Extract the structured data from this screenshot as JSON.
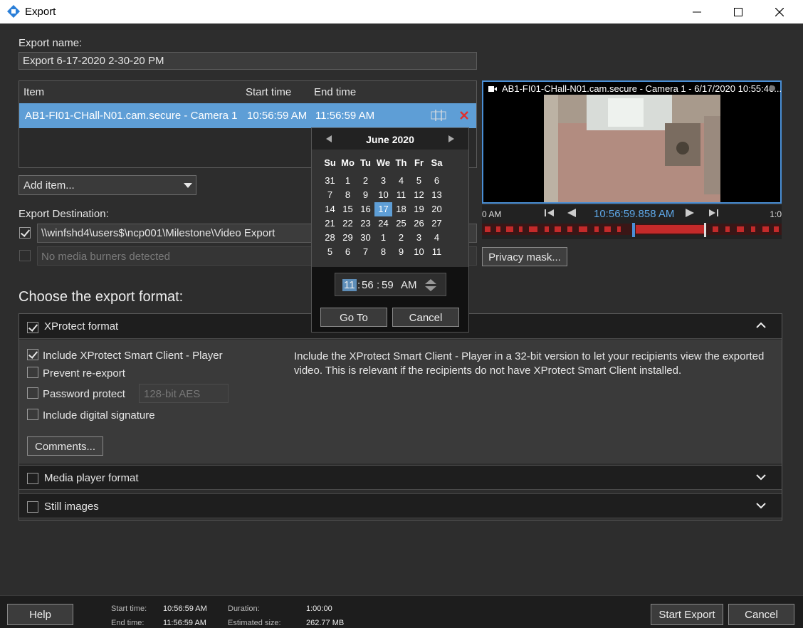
{
  "window": {
    "title": "Export",
    "minimize_icon": "minimize-icon",
    "maximize_icon": "maximize-icon",
    "close_icon": "close-icon"
  },
  "export_name": {
    "label": "Export name:",
    "value": "Export 6-17-2020 2-30-20 PM"
  },
  "items_table": {
    "columns": [
      "Item",
      "Start time",
      "End time"
    ],
    "rows": [
      {
        "item": "AB1-FI01-CHall-N01.cam.secure - Camera 1",
        "start": "10:56:59 AM",
        "end": "11:56:59 AM"
      }
    ],
    "add_item_label": "Add item..."
  },
  "destination": {
    "label": "Export Destination:",
    "path": "\\\\winfshd4\\users$\\ncp001\\Milestone\\Video Export",
    "path_checked": true,
    "burner_text": "No media burners detected",
    "burner_checked": false
  },
  "format_section": {
    "title": "Choose the export format:",
    "xprotect": {
      "label": "XProtect format",
      "checked": true,
      "options": {
        "include_player": "Include XProtect Smart Client - Player",
        "prevent_reexport": "Prevent re-export",
        "password_protect": "Password protect",
        "encryption": "128-bit AES",
        "digital_signature": "Include digital signature"
      },
      "description": "Include the XProtect Smart Client - Player in a 32-bit version to let your recipients view the exported video. This is relevant if the recipients do not have XProtect Smart Client installed.",
      "comments_label": "Comments..."
    },
    "media_player": {
      "label": "Media player format",
      "checked": false
    },
    "still_images": {
      "label": "Still images",
      "checked": false
    }
  },
  "preview": {
    "camera_title": "AB1-FI01-CHall-N01.cam.secure - Camera 1 - 6/17/2020 10:55:46...",
    "current_time": "10:56:59.858 AM",
    "left_time": "0 AM",
    "right_time": "1:0",
    "privacy_mask_label": "Privacy mask..."
  },
  "calendar": {
    "month": "June 2020",
    "weekdays": [
      "Su",
      "Mo",
      "Tu",
      "We",
      "Th",
      "Fr",
      "Sa"
    ],
    "weeks": [
      [
        "31",
        "1",
        "2",
        "3",
        "4",
        "5",
        "6"
      ],
      [
        "7",
        "8",
        "9",
        "10",
        "11",
        "12",
        "13"
      ],
      [
        "14",
        "15",
        "16",
        "17",
        "18",
        "19",
        "20"
      ],
      [
        "21",
        "22",
        "23",
        "24",
        "25",
        "26",
        "27"
      ],
      [
        "28",
        "29",
        "30",
        "1",
        "2",
        "3",
        "4"
      ],
      [
        "5",
        "6",
        "7",
        "8",
        "9",
        "10",
        "11"
      ]
    ],
    "selected_day": "17",
    "time": {
      "hour": "11",
      "minute": "56",
      "second": "59",
      "ampm": "AM"
    },
    "go_to_label": "Go To",
    "cancel_label": "Cancel"
  },
  "footer": {
    "help_label": "Help",
    "start_time_label": "Start time:",
    "start_time": "10:56:59 AM",
    "end_time_label": "End time:",
    "end_time": "11:56:59 AM",
    "duration_label": "Duration:",
    "duration": "1:00:00",
    "size_label": "Estimated size:",
    "size": "262.77 MB",
    "start_export_label": "Start Export",
    "cancel_label": "Cancel"
  },
  "colors": {
    "accent": "#5e9ed6",
    "background": "#2d2d2d",
    "remove": "#e03030"
  }
}
